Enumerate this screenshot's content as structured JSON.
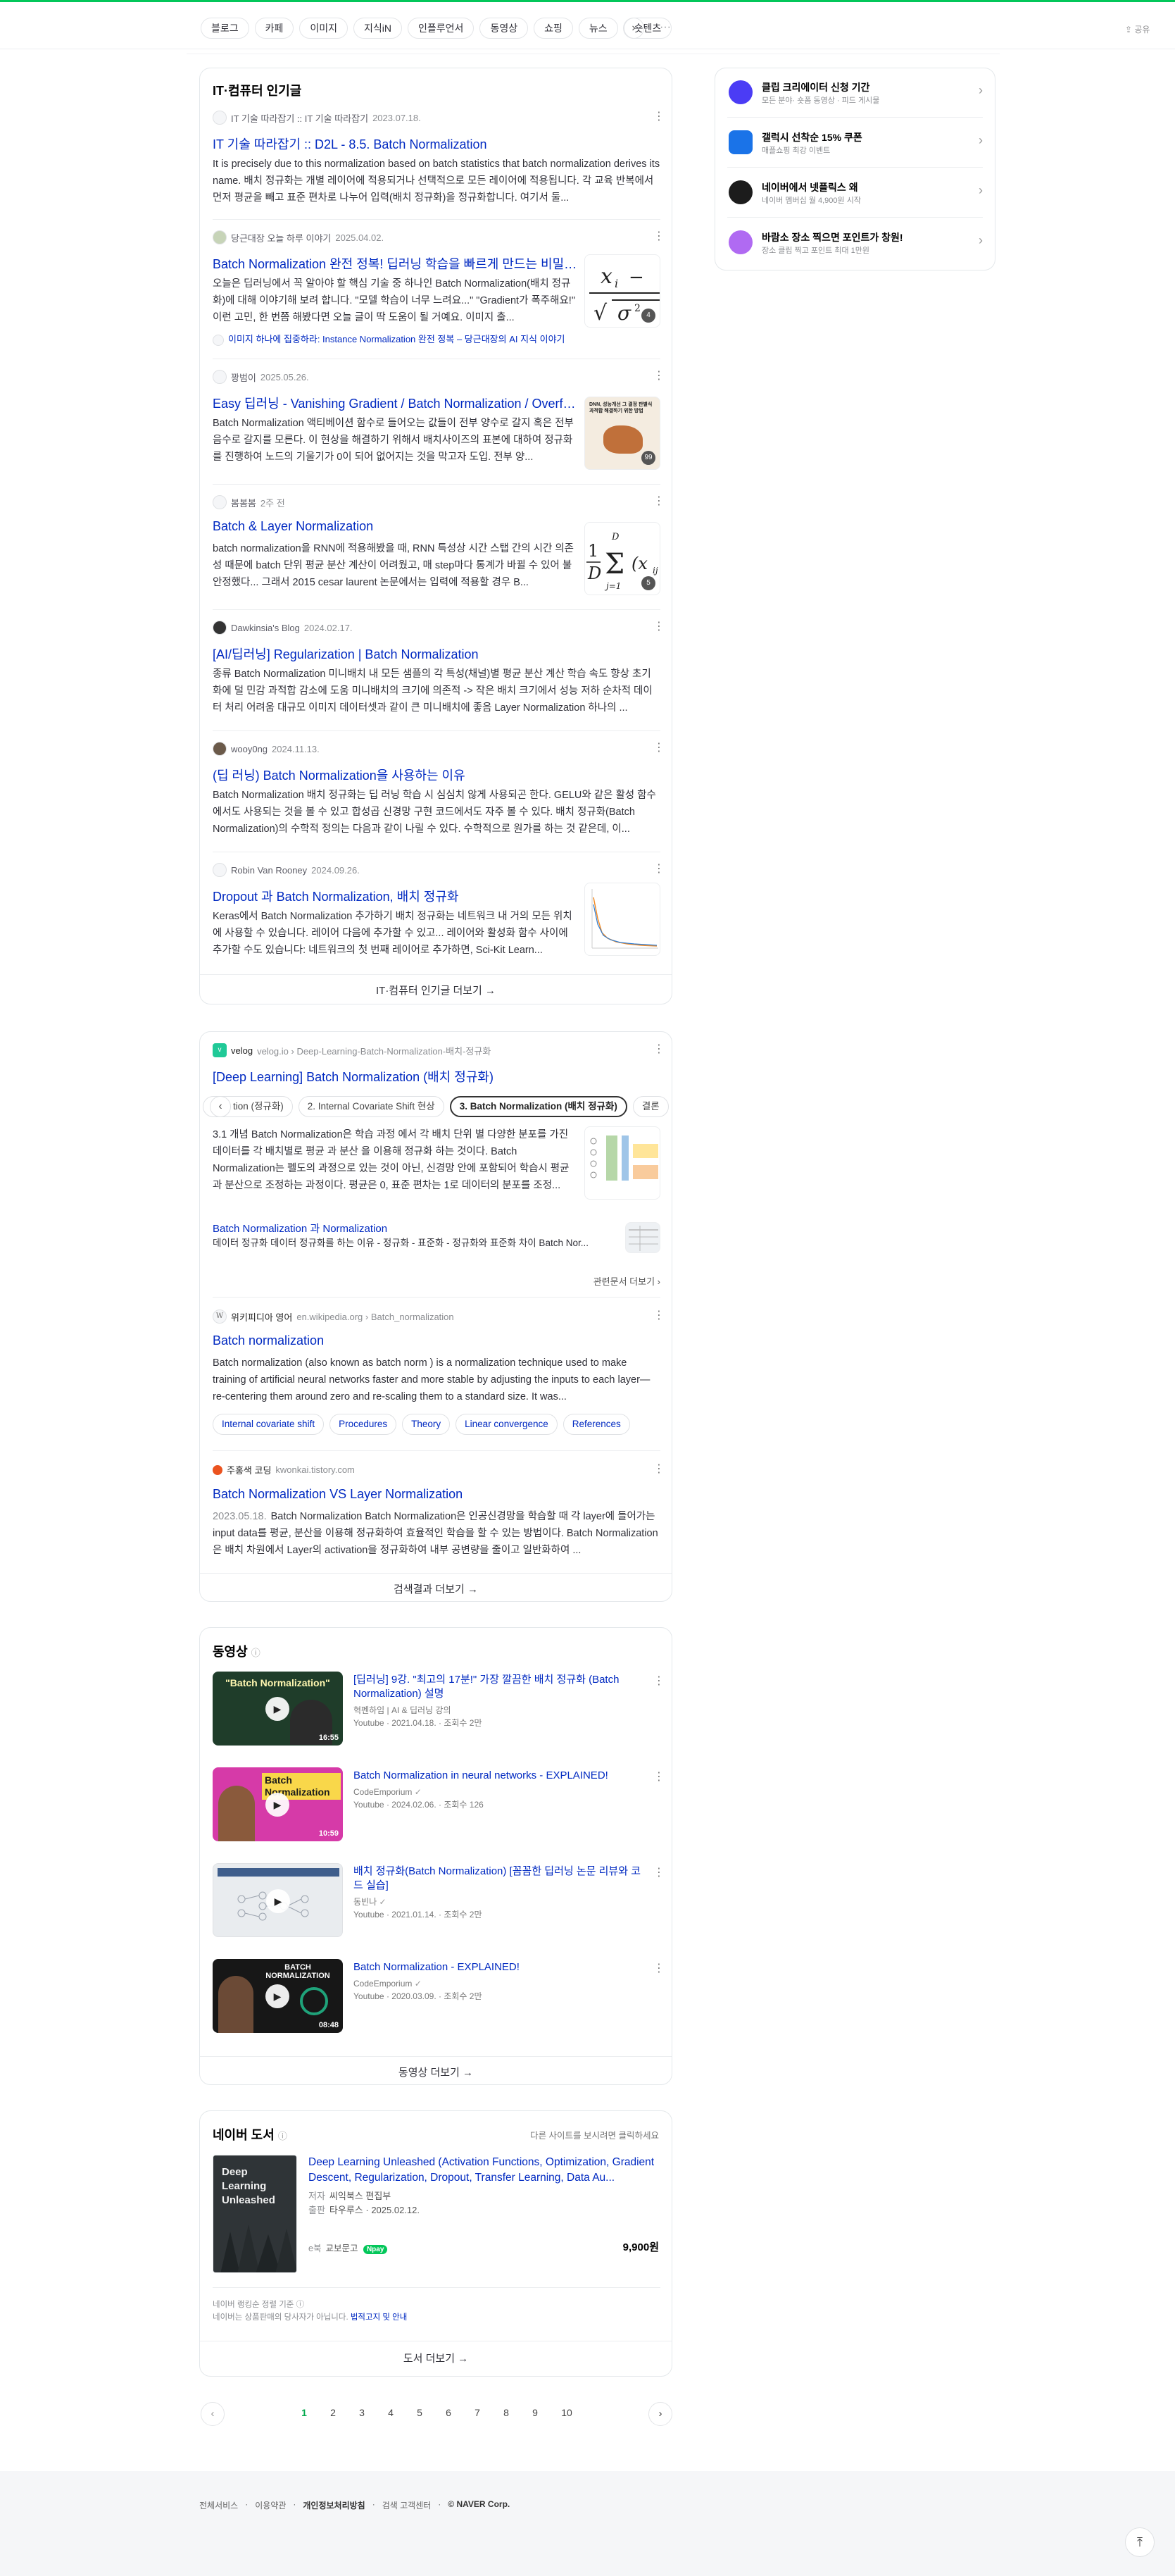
{
  "topbar": {
    "tabs": [
      "블로그",
      "카페",
      "이미지",
      "지식iN",
      "인플루언서",
      "동영상",
      "쇼핑",
      "뉴스",
      "숏텐츠"
    ],
    "arrow": "›",
    "more": "···",
    "share": "⇪ 공유"
  },
  "popular": {
    "title": "IT·컴퓨터 인기글",
    "items": [
      {
        "author": "IT 기술 따라잡기 :: IT 기술 따라잡기",
        "date": "2023.07.18.",
        "title": "IT 기술 따라잡기 :: D2L - 8.5. Batch Normalization",
        "desc": "It is precisely due to this normalization based on batch statistics that batch normalization derives its name. 배치 정규화는 개별 레이어에 적용되거나 선택적으로 모든 레이어에 적용됩니다. 각 교육 반복에서 먼저 평균을 빼고 표준 편차로 나누어 입력(배치 정규화)을 정규화합니다. 여기서 둘..."
      },
      {
        "author": "당근대장 오늘 하루 이야기",
        "date": "2025.04.02.",
        "title": "Batch Normalization 완전 정복! 딥러닝 학습을 빠르게 만드는 비밀 병...",
        "desc": "오늘은 딥러닝에서 꼭 알아야 할 핵심 기술 중 하나인 Batch Normalization(배치 정규화)에 대해 이야기해 보려 합니다. \"모델 학습이 너무 느려요...\" \"Gradient가 폭주해요!\" 이런 고민, 한 번쯤 해봤다면 오늘 글이 딱 도움이 될 거예요. 이미지 출...",
        "sub": "이미지 하나에 집중하라: Instance Normalization 완전 정복 – 당근대장의 AI 지식 이야기"
      },
      {
        "author": "꽝범이",
        "date": "2025.05.26.",
        "title": "Easy 딥러닝 - Vanishing Gradient / Batch Normalization / Overfit...",
        "desc": "Batch Normalization 액티베이션 함수로 들어오는 값들이 전부 양수로 갈지 혹은 전부 음수로 갈지를 모른다. 이 현상을 해결하기 위해서 배치사이즈의 표본에 대하여 정규화를 진행하여 노드의 기울기가 0이 되어 없어지는 것을 막고자 도입. 전부 양...",
        "badge": "99"
      },
      {
        "author": "봄봄봄",
        "date": "2주 전",
        "title": "Batch & Layer Normalization",
        "desc": "batch normalization을 RNN에 적용해봤을 때, RNN 특성상 시간 스탭 간의 시간 의존성 때문에 batch 단위 평균 분산 계산이 어려웠고, 매 step마다 통계가 바뀔 수 있어 불안정했다... 그래서 2015 cesar laurent 논문에서는 입력에 적용할 경우 B...",
        "badge": "5"
      },
      {
        "author": "Dawkinsia's Blog",
        "date": "2024.02.17.",
        "title": "[AI/딥러닝] Regularization | Batch Normalization",
        "desc": "종류 Batch Normalization 미니배치 내 모든 샘플의 각 특성(채널)별 평균 분산 계산 학습 속도 향상 초기화에 덜 민감 과적합 감소에 도움 미니배치의 크기에 의존적 -> 작은 배치 크기에서 성능 저하 순차적 데이터 처리 어려움 대규모 이미지 데이터셋과 같이 큰 미니배치에 좋음 Layer Normalization 하나의 ..."
      },
      {
        "author": "wooy0ng",
        "date": "2024.11.13.",
        "title": "(딥 러닝) Batch Normalization을 사용하는 이유",
        "desc": "Batch Normalization 배치 정규화는 딥 러닝 학습 시 심심치 않게 사용되곤 한다. GELU와 같은 활성 함수에서도 사용되는 것을 볼 수 있고 합성곱 신경망 구현 코드에서도 자주 볼 수 있다. 배치 정규화(Batch Normalization)의 수학적 정의는 다음과 같이 나릴 수 있다. 수학적으로 원가를 하는 것 같은데, 이..."
      },
      {
        "author": "Robin Van Rooney",
        "date": "2024.09.26.",
        "title": "Dropout 과 Batch Normalization, 배치 정규화",
        "desc": "Keras에서 Batch Normalization 추가하기 배치 정규화는 네트워크 내 거의 모든 위치에 사용할 수 있습니다. 레이어 다음에 추가할 수 있고... 레이어와 활성화 함수 사이에 추가할 수도 있습니다: 네트워크의 첫 번째 레이어로 추가하면, Sci-Kit Learn..."
      }
    ],
    "more": "IT·컴퓨터 인기글 더보기 →"
  },
  "web": {
    "velog": {
      "site": "velog",
      "path": "velog.io › Deep-Learning-Batch-Normalization-배치-정규화",
      "title": "[Deep Learning] Batch Normalization (배치 정규화)",
      "chips": [
        "tion (정규화)",
        "2. Internal Covariate Shift 현상",
        "3. Batch Normalization (배치 정규화)",
        "결론"
      ],
      "desc": "3.1 개념 Batch Normalization은 학습 과정 에서 각 배치 단위 별 다양한 분포를 가진 데이터를 각 배치별로 평균 과 분산 을 이용해 정규화 하는 것이다. Batch Normalization는 펠도의 과정으로 있는 것이 아닌, 신경망 안에 포함되어 학습시 평균과 분산으로 조정하는 과정이다. 평균은 0, 표준 편차는 1로 데이터의 분포를 조정...",
      "sub_title": "Batch Normalization 과 Normalization",
      "sub_desc": "데이터 정규화 데이터 정규화를 하는 이유 - 정규화 - 표준화 - 정규화와 표준화 차이 Batch Nor...",
      "related": "관련문서 더보기 ›"
    },
    "wiki": {
      "site": "위키피디아 영어",
      "path": "en.wikipedia.org › Batch_normalization",
      "title": "Batch normalization",
      "desc": "Batch normalization (also known as batch norm ) is a normalization technique used to make training of artificial neural networks faster and more stable by adjusting the inputs to each layer—re-centering them around zero and re-scaling them to a standard size. It was...",
      "chips": [
        "Internal covariate shift",
        "Procedures",
        "Theory",
        "Linear convergence",
        "References"
      ]
    },
    "tistory": {
      "site": "주홍색 코딩",
      "path": "kwonkai.tistory.com",
      "title": "Batch Normalization VS Layer Normalization",
      "date": "2023.05.18.",
      "desc": "Batch Normalization Batch Normalization은 인공신경망을 학습할 때 각 layer에 들어가는 input data를 평균, 분산을 이용해 정규화하여 효율적인 학습을 할 수 있는 방법이다. Batch Normalization은 배치 차원에서 Layer의 activation을 정규화하여 내부 공변량을 줄이고 일반화하여 ..."
    },
    "more": "검색결과 더보기 →"
  },
  "videos": {
    "title": "동영상",
    "items": [
      {
        "title": "[딥러닝] 9강. \"최고의 17분!\" 가장 깔끔한 배치 정규화 (Batch Normalization) 설명",
        "channel": "혁펜하임 | AI & 딥러닝 강의",
        "meta": "Youtube · 2021.04.18. · 조회수 2만",
        "duration": "16:55",
        "thumb_text": "\"Batch Normalization\""
      },
      {
        "title": "Batch Normalization in neural networks - EXPLAINED!",
        "channel": "CodeEmporium",
        "meta": "Youtube · 2024.02.06. · 조회수 126",
        "duration": "10:59",
        "thumb_text": "Batch Normalization"
      },
      {
        "title": "배치 정규화(Batch Normalization) [꼼꼼한 딥러닝 논문 리뷰와 코드 실습]",
        "channel": "동빈나",
        "meta": "Youtube · 2021.01.14. · 조회수 2만",
        "duration": "",
        "thumb_text": ""
      },
      {
        "title": "Batch Normalization - EXPLAINED!",
        "channel": "CodeEmporium",
        "meta": "Youtube · 2020.03.09. · 조회수 2만",
        "duration": "08:48",
        "thumb_text": "BATCH NORMALIZATION"
      }
    ],
    "more": "동영상 더보기 →"
  },
  "books": {
    "title": "네이버 도서",
    "hint": "다른 사이트를 보시려면 클릭하세요",
    "book_title": "Deep Learning Unleashed (Activation Functions, Optimization, Gradient Descent, Regularization, Dropout, Transfer Learning, Data Au...",
    "author_label": "저자",
    "author": "씨익북스 편집부",
    "publisher_label": "출판",
    "publisher": "타우루스 · 2025.02.12.",
    "store_type": "e북",
    "store": "교보문고",
    "pay": "Npay",
    "price": "9,900원",
    "cover_text": "Deep Learning Unleashed",
    "disclaimer1": "네이버 랭킹순 정렬 기준 ⓘ",
    "disclaimer2_a": "네이버는 상품판매의 당사자가 아닙니다.",
    "disclaimer2_b": "법적고지 및 안내",
    "more": "도서 더보기 →"
  },
  "side": {
    "items": [
      {
        "title": "클립 크리에이터 신청 기간",
        "sub": "모든 분야· 숏폼 동영상 · 피드 게시물",
        "color": "#4b3cf5"
      },
      {
        "title": "갤럭시 선착순 15% 쿠폰",
        "sub": "매플쇼핑 최강 이벤트",
        "color": "#1a73e8"
      },
      {
        "title": "네이버에서 넷플릭스 왜",
        "sub": "네이버 멤버십 월 4,900원 시작",
        "color": "#1c1c1c"
      },
      {
        "title": "바람소 장소 찍으면 포인트가 창원!",
        "sub": "장소 클립 찍고 포인트 최대 1만원",
        "color": "#b06af2"
      }
    ]
  },
  "pager": {
    "pages": [
      "1",
      "2",
      "3",
      "4",
      "5",
      "6",
      "7",
      "8",
      "9",
      "10"
    ],
    "prev": "‹",
    "next": "›"
  },
  "footer": {
    "links": [
      "전체서비스",
      "이용약관",
      "개인정보처리방침",
      "검색 고객센터",
      "© NAVER Corp."
    ],
    "to_top": "⤒"
  }
}
